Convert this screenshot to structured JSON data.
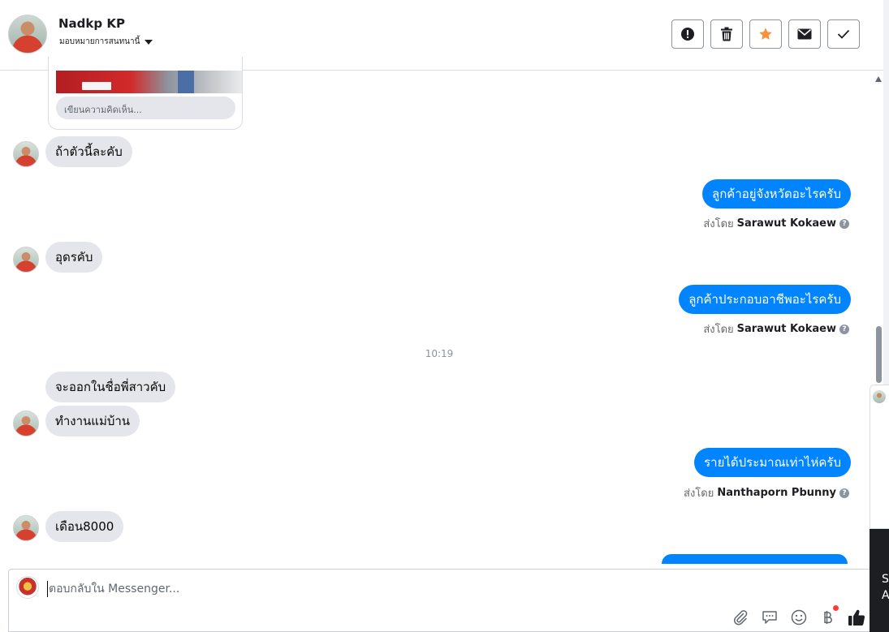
{
  "header": {
    "name": "Nadkp KP",
    "assign_label": "มอบหมายการสนทนานี้",
    "actions": [
      "spam-icon",
      "trash-icon",
      "star-icon",
      "envelope-icon",
      "check-icon"
    ],
    "star_color": "#f7923b"
  },
  "shared_card": {
    "comment_placeholder": "เขียนความคิดเห็น..."
  },
  "messages": [
    {
      "direction": "in",
      "text": "ถ้าตัวนี้ละคับ"
    },
    {
      "direction": "out",
      "text": "ลูกค้าอยู่จังหวัดอะไรครับ",
      "sent_by_label": "ส่งโดย",
      "sender": "Sarawut Kokaew"
    },
    {
      "direction": "in",
      "text": "อุดรคับ"
    },
    {
      "direction": "out",
      "text": "ลูกค้าประกอบอาชีพอะไรครับ",
      "sent_by_label": "ส่งโดย",
      "sender": "Sarawut Kokaew"
    },
    {
      "direction": "in",
      "text": "จะออกในชื่อพี่สาวคับ"
    },
    {
      "direction": "in",
      "text": "ทำงานแม่บ้าน"
    },
    {
      "direction": "out",
      "text": "รายได้ประมาณเท่าไห่ครับ",
      "sent_by_label": "ส่งโดย",
      "sender": "Nanthaporn Pbunny"
    },
    {
      "direction": "in",
      "text": "เดือน8000"
    }
  ],
  "timestamp": "10:19",
  "composer": {
    "placeholder": "ตอบกลับใน Messenger...",
    "icons": [
      "attachment-icon",
      "saved-reply-icon",
      "emoji-icon",
      "baht-payment-icon",
      "like-icon"
    ]
  },
  "side_panel": {
    "text_line1": "S",
    "text_line2": "A"
  },
  "colors": {
    "outgoing_bubble": "#0084ff",
    "incoming_bubble": "#e4e6eb"
  }
}
